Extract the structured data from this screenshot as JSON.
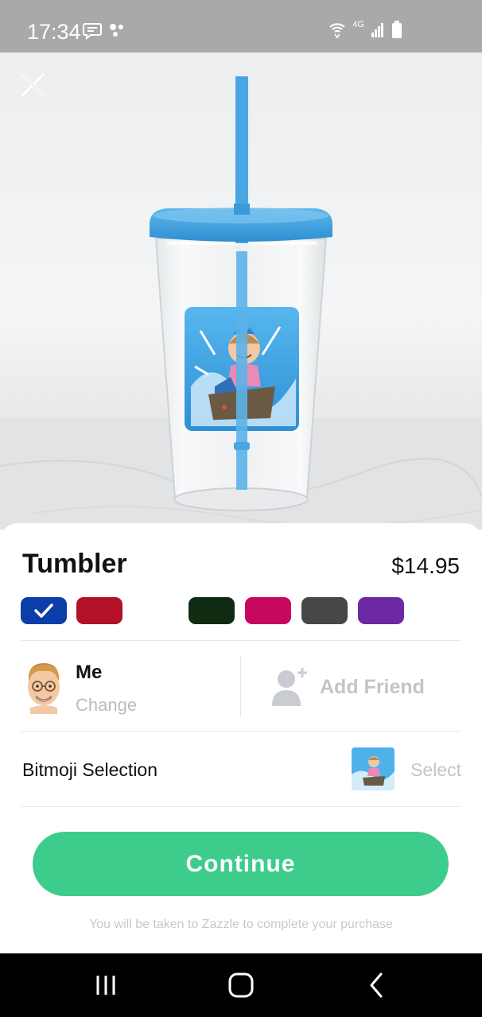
{
  "status_bar": {
    "time": "17:34",
    "network": "4G",
    "icons": [
      "message-icon",
      "dots-icon",
      "wifi-icon",
      "signal-icon",
      "battery-icon"
    ]
  },
  "product_image": {
    "close_icon": "close-icon"
  },
  "product": {
    "title": "Tumbler",
    "price": "$14.95"
  },
  "colors": {
    "swatches": [
      {
        "name": "blue",
        "hex": "#0b3ea8",
        "selected": true
      },
      {
        "name": "red",
        "hex": "#b3102a",
        "selected": false
      },
      {
        "name": "dark-green",
        "hex": "#0f2c12",
        "selected": false
      },
      {
        "name": "magenta",
        "hex": "#c6085f",
        "selected": false
      },
      {
        "name": "dark-gray",
        "hex": "#474747",
        "selected": false
      },
      {
        "name": "purple",
        "hex": "#6d29a3",
        "selected": false
      }
    ],
    "accent": "#3ecc8c"
  },
  "people": {
    "me_label": "Me",
    "change_label": "Change",
    "add_friend_label": "Add Friend"
  },
  "bitmoji": {
    "label": "Bitmoji Selection",
    "select_label": "Select"
  },
  "actions": {
    "continue_label": "Continue",
    "footnote": "You will be taken to Zazzle to complete your purchase"
  },
  "nav_bar": {
    "icons": [
      "recents-icon",
      "home-icon",
      "back-icon"
    ]
  }
}
